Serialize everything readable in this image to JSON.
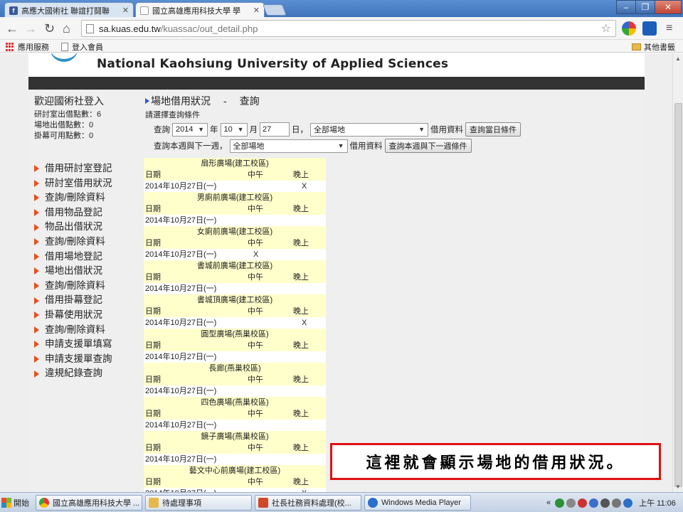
{
  "browser": {
    "tabs": [
      {
        "title": "高應大國術社 聯誼打鬪聯",
        "favicon": "facebook-icon",
        "active": false
      },
      {
        "title": "國立高雄應用科技大學 學",
        "favicon": "page-icon",
        "active": true
      }
    ],
    "url_host": "sa.kuas.edu.tw",
    "url_path": "/kuassac/out_detail.php",
    "bookmarks": {
      "apps": "應用服務",
      "login": "登入會員",
      "other": "其他書籤"
    }
  },
  "page": {
    "banner_title": "National Kaohsiung University of Applied Sciences",
    "welcome": "歡迎國術社登入",
    "counts": [
      {
        "label": "研討室出借點數：6"
      },
      {
        "label": "場地出借點數：0"
      },
      {
        "label": "掛幕可用點數：0"
      }
    ],
    "menu": [
      "借用研討室登記",
      "研討室借用狀況",
      "查詢/刪除資料",
      "借用物品登記",
      "物品出借狀況",
      "查詢/刪除資料",
      "借用場地登記",
      "場地出借狀況",
      "查詢/刪除資料",
      "借用掛幕登記",
      "掛幕使用狀況",
      "查詢/刪除資料",
      "申請支援單填寫",
      "申請支援單查詢",
      "違規紀錄查詢"
    ],
    "breadcrumb": {
      "section": "場地借用狀況",
      "sep": "-",
      "action": "查詢"
    },
    "instruction": "請選擇查詢條件",
    "query_day": {
      "label_query": "查詢",
      "year": "2014",
      "year_unit": "年",
      "month": "10",
      "month_unit": "月",
      "day": "27",
      "day_unit": "日，",
      "venue": "全部場地",
      "info_label": "借用資料",
      "button": "查詢當日條件"
    },
    "query_week": {
      "label": "查詢本週與下一週，",
      "venue": "全部場地",
      "info_label": "借用資料",
      "button": "查詢本週與下一週條件"
    },
    "results": {
      "headers": {
        "date": "日期",
        "noon": "中午",
        "evening": "晚上"
      },
      "venues": [
        {
          "name": "扇形廣場(建工校區)",
          "date": "2014年10月27日(一)",
          "noon": "",
          "evening": "X"
        },
        {
          "name": "男廁前廣場(建工校區)",
          "date": "2014年10月27日(一)",
          "noon": "",
          "evening": ""
        },
        {
          "name": "女廁前廣場(建工校區)",
          "date": "2014年10月27日(一)",
          "noon": "X",
          "evening": ""
        },
        {
          "name": "書城前廣場(建工校區)",
          "date": "2014年10月27日(一)",
          "noon": "",
          "evening": ""
        },
        {
          "name": "書城頂廣場(建工校區)",
          "date": "2014年10月27日(一)",
          "noon": "",
          "evening": "X"
        },
        {
          "name": "圓型廣場(燕巢校區)",
          "date": "2014年10月27日(一)",
          "noon": "",
          "evening": ""
        },
        {
          "name": "長廊(燕巢校區)",
          "date": "2014年10月27日(一)",
          "noon": "",
          "evening": ""
        },
        {
          "name": "四色廣場(燕巢校區)",
          "date": "2014年10月27日(一)",
          "noon": "",
          "evening": ""
        },
        {
          "name": "鏡子廣場(燕巢校區)",
          "date": "2014年10月27日(一)",
          "noon": "",
          "evening": ""
        },
        {
          "name": "藝文中心前廣場(建工校區)",
          "date": "2014年10月27日(一)",
          "noon": "",
          "evening": "X"
        }
      ]
    }
  },
  "callout": {
    "text": "這裡就會顯示場地的借用狀況。",
    "border_color": "#e01010"
  },
  "taskbar": {
    "start": "開始",
    "items": [
      {
        "label": "國立高雄應用科技大學 ...",
        "icon": "chrome-icon"
      },
      {
        "label": "待處理事項",
        "icon": "folder-icon"
      },
      {
        "label": "社長社務資料處理(校...",
        "icon": "powerpoint-icon"
      },
      {
        "label": "Windows Media Player",
        "icon": "media-player-icon"
      }
    ],
    "clock": "上午 11:06"
  }
}
